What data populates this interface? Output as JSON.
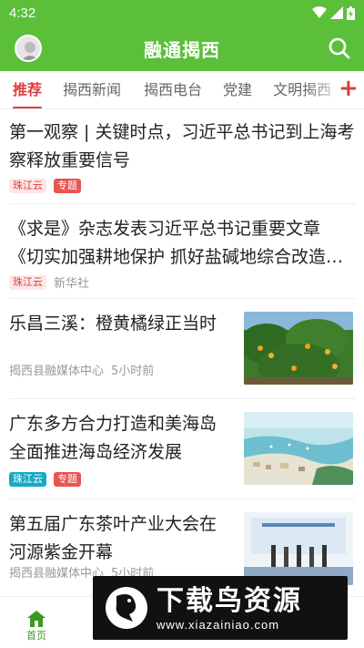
{
  "status_bar": {
    "time": "4:32"
  },
  "app_bar": {
    "title": "融通揭西"
  },
  "tabs": [
    {
      "label": "推荐",
      "active": true
    },
    {
      "label": "揭西新闻"
    },
    {
      "label": "揭西电台"
    },
    {
      "label": "党建"
    },
    {
      "label": "文明揭西"
    }
  ],
  "tab_add_label": "+",
  "feed": [
    {
      "title": "第一观察 | 关键时点，习近平总书记到上海考察释放重要信号",
      "badges": [
        "珠江云",
        "专题"
      ]
    },
    {
      "title": "《求是》杂志发表习近平总书记重要文章《切实加强耕地保护 抓好盐碱地综合改造…",
      "badges": [
        "珠江云"
      ],
      "source": "新华社"
    },
    {
      "title": "乐昌三溪：橙黄橘绿正当时",
      "source": "揭西县融媒体中心",
      "time": "5小时前",
      "image": "orange-orchard-photo"
    },
    {
      "title": "广东多方合力打造和美海岛 全面推进海岛经济发展",
      "badges": [
        "珠江云",
        "专题"
      ],
      "image": "island-aerial-photo"
    },
    {
      "title": "第五届广东茶叶产业大会在河源紫金开幕",
      "source": "揭西县融媒体中心",
      "time": "5小时前",
      "image": "tea-conference-photo"
    }
  ],
  "bottom_nav": {
    "home": "首页"
  },
  "watermark": {
    "main": "下载鸟资源",
    "url": "www.xiazainiao.com"
  },
  "colors": {
    "brand_green": "#5bbf3a",
    "accent_red": "#e13c3c",
    "badge_teal": "#19a8c4"
  }
}
